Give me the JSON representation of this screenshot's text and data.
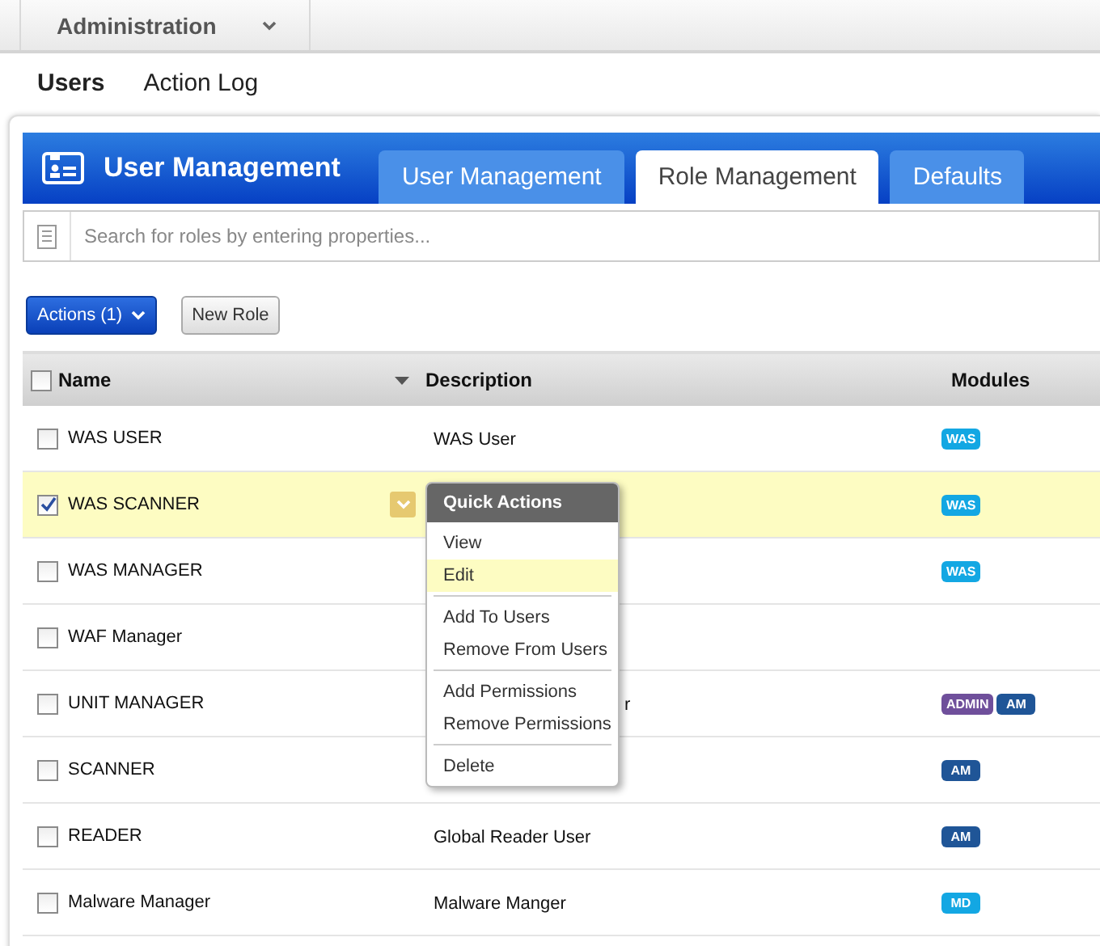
{
  "top_menu": {
    "label": "Administration"
  },
  "subnav": [
    {
      "label": "Users",
      "selected": true
    },
    {
      "label": "Action Log",
      "selected": false
    }
  ],
  "panel": {
    "title": "User Management",
    "tabs": [
      {
        "label": "User Management",
        "selected": false
      },
      {
        "label": "Role Management",
        "selected": true
      },
      {
        "label": "Defaults",
        "selected": false
      }
    ]
  },
  "search": {
    "placeholder": "Search for roles by entering properties..."
  },
  "toolbar": {
    "actions_button": "Actions (1)",
    "new_button": "New Role"
  },
  "table": {
    "columns": [
      "Name",
      "Description",
      "Modules"
    ],
    "select_all_checked": false,
    "rows": [
      {
        "name": "WAS USER",
        "description": "WAS User",
        "checked": false,
        "selected": false,
        "modules": [
          {
            "label": "WAS",
            "color": "#13a7e3"
          }
        ]
      },
      {
        "name": "WAS SCANNER",
        "checked": true,
        "selected": true,
        "modules": [
          {
            "label": "WAS",
            "color": "#13a7e3"
          }
        ]
      },
      {
        "name": "WAS MANAGER",
        "checked": false,
        "selected": false,
        "modules": [
          {
            "label": "WAS",
            "color": "#13a7e3"
          }
        ]
      },
      {
        "name": "WAF Manager",
        "checked": false,
        "selected": false,
        "modules": []
      },
      {
        "name": "UNIT MANAGER",
        "description_tail": "r",
        "checked": false,
        "selected": false,
        "modules": [
          {
            "label": "ADMIN",
            "color": "#6f4f9b"
          },
          {
            "label": "AM",
            "color": "#1f5597"
          }
        ]
      },
      {
        "name": "SCANNER",
        "checked": false,
        "selected": false,
        "modules": [
          {
            "label": "AM",
            "color": "#1f5597"
          }
        ]
      },
      {
        "name": "READER",
        "description": "Global Reader User",
        "checked": false,
        "selected": false,
        "modules": [
          {
            "label": "AM",
            "color": "#1f5597"
          }
        ]
      },
      {
        "name": "Malware Manager",
        "description": "Malware Manger",
        "checked": false,
        "selected": false,
        "modules": [
          {
            "label": "MD",
            "color": "#13a7e3"
          }
        ]
      }
    ]
  },
  "quick_actions": {
    "title": "Quick Actions",
    "groups": [
      [
        {
          "label": "View",
          "highlighted": false
        },
        {
          "label": "Edit",
          "highlighted": true
        }
      ],
      [
        {
          "label": "Add To Users",
          "highlighted": false
        },
        {
          "label": "Remove From Users",
          "highlighted": false
        }
      ],
      [
        {
          "label": "Add Permissions",
          "highlighted": false
        },
        {
          "label": "Remove Permissions",
          "highlighted": false
        }
      ],
      [
        {
          "label": "Delete",
          "highlighted": false
        }
      ]
    ]
  }
}
